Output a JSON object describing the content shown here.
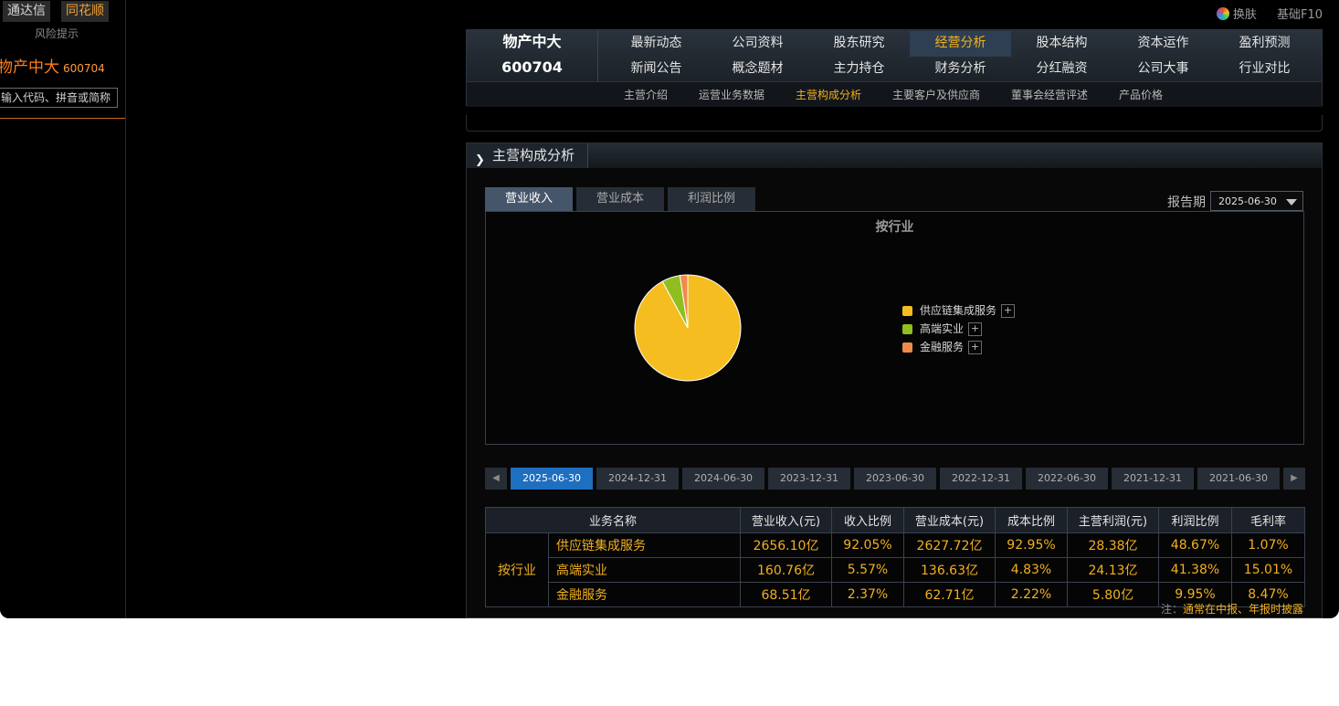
{
  "left_panel": {
    "source_tabs": [
      "通达信",
      "同花顺"
    ],
    "risk_link": "风险提示",
    "stock_name": "物产中大",
    "stock_code": "600704",
    "search_placeholder": "输入代码、拼音或简称"
  },
  "top_right": {
    "skin": "换肤",
    "basic_f10": "基础F10"
  },
  "nav": {
    "logo_name": "物产中大",
    "logo_code": "600704",
    "row1": [
      "最新动态",
      "公司资料",
      "股东研究",
      "经营分析",
      "股本结构",
      "资本运作",
      "盈利预测"
    ],
    "row2": [
      "新闻公告",
      "概念题材",
      "主力持仓",
      "财务分析",
      "分红融资",
      "公司大事",
      "行业对比"
    ],
    "active": "经营分析",
    "sub": [
      "主营介绍",
      "运营业务数据",
      "主营构成分析",
      "主要客户及供应商",
      "董事会经营评述",
      "产品价格"
    ],
    "sub_active": "主营构成分析"
  },
  "section": {
    "title": "主营构成分析",
    "tabs": [
      "营业收入",
      "营业成本",
      "利润比例"
    ],
    "active_tab": "营业收入",
    "report_period_label": "报告期",
    "report_period_value": "2025-06-30"
  },
  "chart_data": {
    "type": "pie",
    "title": "按行业",
    "categories": [
      "供应链集成服务",
      "高端实业",
      "金融服务"
    ],
    "values": [
      92.05,
      5.57,
      2.37
    ],
    "colors": [
      "#f5bd1f",
      "#8fbe1e",
      "#f08a4b"
    ],
    "legend_position": "right"
  },
  "dates": [
    "2025-06-30",
    "2024-12-31",
    "2024-06-30",
    "2023-12-31",
    "2023-06-30",
    "2022-12-31",
    "2022-06-30",
    "2021-12-31",
    "2021-06-30"
  ],
  "active_date": "2025-06-30",
  "table": {
    "headers": [
      "业务名称",
      "营业收入(元)",
      "收入比例",
      "营业成本(元)",
      "成本比例",
      "主营利润(元)",
      "利润比例",
      "毛利率"
    ],
    "category": "按行业",
    "rows": [
      {
        "name": "供应链集成服务",
        "revenue": "2656.10亿",
        "rev_ratio": "92.05%",
        "cost": "2627.72亿",
        "cost_ratio": "92.95%",
        "profit": "28.38亿",
        "profit_ratio": "48.67%",
        "margin": "1.07%"
      },
      {
        "name": "高端实业",
        "revenue": "160.76亿",
        "rev_ratio": "5.57%",
        "cost": "136.63亿",
        "cost_ratio": "4.83%",
        "profit": "24.13亿",
        "profit_ratio": "41.38%",
        "margin": "15.01%"
      },
      {
        "name": "金融服务",
        "revenue": "68.51亿",
        "rev_ratio": "2.37%",
        "cost": "62.71亿",
        "cost_ratio": "2.22%",
        "profit": "5.80亿",
        "profit_ratio": "9.95%",
        "margin": "8.47%"
      }
    ],
    "note_label": "注：",
    "note": "通常在中报、年报时披露"
  }
}
